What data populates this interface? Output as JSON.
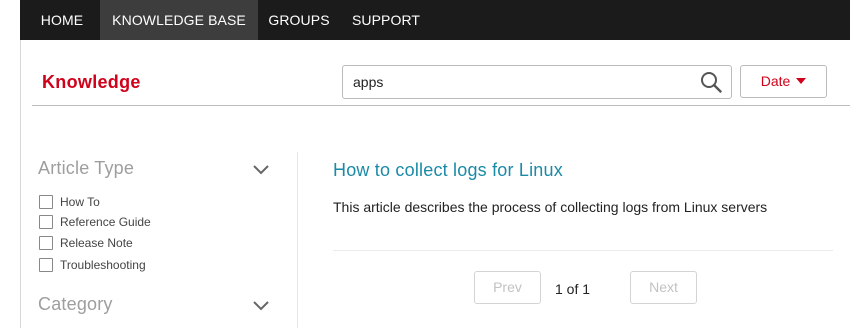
{
  "nav": {
    "items": [
      {
        "label": "HOME",
        "active": false
      },
      {
        "label": "KNOWLEDGE BASE",
        "active": true
      },
      {
        "label": "GROUPS",
        "active": false
      },
      {
        "label": "SUPPORT",
        "active": false
      }
    ]
  },
  "header": {
    "brand": "Knowledge",
    "search": {
      "value": "apps",
      "placeholder": ""
    },
    "sort_label": "Date"
  },
  "sidebar": {
    "facets": [
      {
        "title": "Article Type",
        "expanded": true,
        "options": [
          {
            "label": "How To",
            "checked": false
          },
          {
            "label": "Reference Guide",
            "checked": false
          },
          {
            "label": "Release Note",
            "checked": false
          },
          {
            "label": "Troubleshooting",
            "checked": false
          }
        ]
      },
      {
        "title": "Category",
        "expanded": false,
        "options": []
      }
    ]
  },
  "results": [
    {
      "title": "How to collect logs for Linux",
      "description": "This article describes the process of collecting logs from Linux servers"
    }
  ],
  "pagination": {
    "prev_label": "Prev",
    "next_label": "Next",
    "page_text": "1 of 1"
  },
  "colors": {
    "brand": "#d0021b",
    "nav_bg": "#1b1b1b",
    "nav_active_bg": "#3d3d3d",
    "link": "#1a8aa6",
    "facet_title": "#9e9e9e"
  },
  "icons": {
    "search": "search-icon",
    "sort_caret": "caret-down-icon",
    "facet_toggle": "chevron-down-icon"
  }
}
